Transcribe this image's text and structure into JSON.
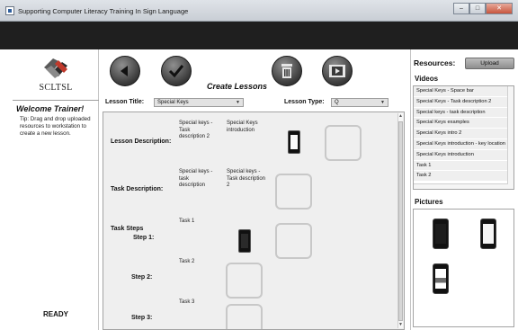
{
  "window": {
    "title": "Supporting Computer Literacy Training In Sign Language",
    "controls": [
      "minimize",
      "maximize",
      "close"
    ]
  },
  "logo": {
    "text": "SCLTSL",
    "icon": "hands-logo-icon"
  },
  "sidebar": {
    "welcome_title": "Welcome Trainer!",
    "tip": "Tip: Drag and drop uploaded resources to workstation to create a new lesson.",
    "status": "READY"
  },
  "toolbar": {
    "back_icon": "back-arrow-icon",
    "confirm_icon": "checkmark-icon",
    "delete_icon": "trash-icon",
    "video_icon": "film-icon"
  },
  "page_title": "Create Lessons",
  "lesson": {
    "title_label": "Lesson Title:",
    "title_value": "Special Keys",
    "type_label": "Lesson Type:",
    "type_value": "Q"
  },
  "workspace": {
    "lesson_description": {
      "label": "Lesson Description:",
      "cells": [
        "Special keys - Task description 2",
        "Special Keys introduction"
      ]
    },
    "task_description": {
      "label": "Task Description:",
      "cells": [
        "Special keys - task description",
        "Special keys - Task description 2"
      ]
    },
    "task_steps_label": "Task Steps",
    "steps": [
      {
        "label": "Step 1:",
        "task": "Task 1"
      },
      {
        "label": "Step 2:",
        "task": "Task 2"
      },
      {
        "label": "Step 3:",
        "task": "Task 3"
      }
    ]
  },
  "resources": {
    "title": "Resources:",
    "upload_label": "Upload",
    "videos_title": "Videos",
    "videos": [
      "Special Keys - Space bar",
      "Special Keys - Task description 2",
      "Special keys - task description",
      "Special Keys examples",
      "Special Keys intro 2",
      "Special Keys introduction - key location",
      "Special Keys introduction",
      "Task 1",
      "Task 2"
    ],
    "pictures_title": "Pictures"
  },
  "colors": {
    "dark_band": "#1f1f1f",
    "workspace_bg": "#efefef",
    "drop_box_border": "#c8c8c8",
    "button_dark": "#3a3a3a"
  }
}
